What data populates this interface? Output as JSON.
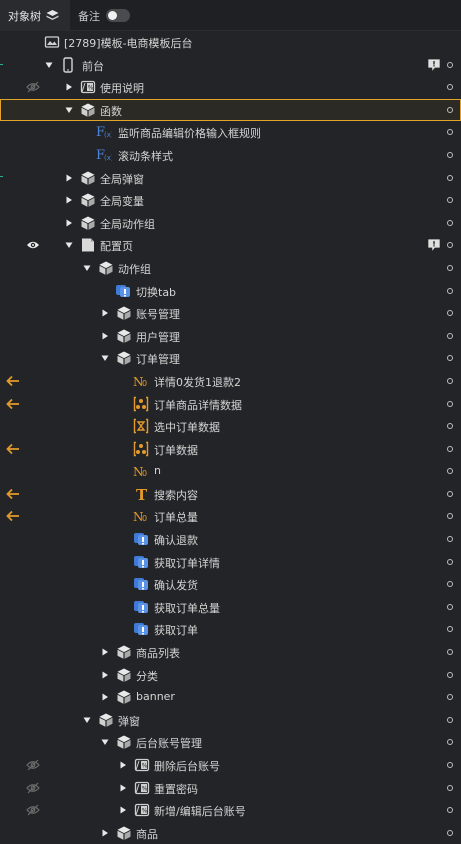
{
  "tabs": {
    "object_tree": "对象树",
    "notes": "备注"
  },
  "tree": {
    "root": "[2789]模板-电商模板后台",
    "frontstage": "前台",
    "usage": "使用说明",
    "functions": "函数",
    "fn_1": "监听商品编辑价格输入框规则",
    "fn_2": "滚动条样式",
    "global_popup": "全局弹窗",
    "global_vars": "全局变量",
    "global_actions": "全局动作组",
    "config_page": "配置页",
    "action_group": "动作组",
    "switch_tab": "切换tab",
    "account_mgmt": "账号管理",
    "user_mgmt": "用户管理",
    "order_mgmt": "订单管理",
    "order_detail_0": "详情0发货1退款2",
    "order_product_detail": "订单商品详情数据",
    "selected_order": "选中订单数据",
    "order_data": "订单数据",
    "var_n": "n",
    "search_content": "搜索内容",
    "order_total": "订单总量",
    "confirm_refund": "确认退款",
    "get_order_detail": "获取订单详情",
    "confirm_ship": "确认发货",
    "get_order_total": "获取订单总量",
    "get_orders": "获取订单",
    "product_list": "商品列表",
    "category": "分类",
    "banner": "banner",
    "popups": "弹窗",
    "backend_account_mgmt": "后台账号管理",
    "delete_backend_account": "删除后台账号",
    "reset_password": "重置密码",
    "add_edit_backend_account": "新增/编辑后台账号",
    "products": "商品"
  },
  "colors": {
    "background": "#232427",
    "selection_border": "#e2a32a",
    "accent_orange": "#e39a2b",
    "accent_blue": "#3f7bd6"
  }
}
